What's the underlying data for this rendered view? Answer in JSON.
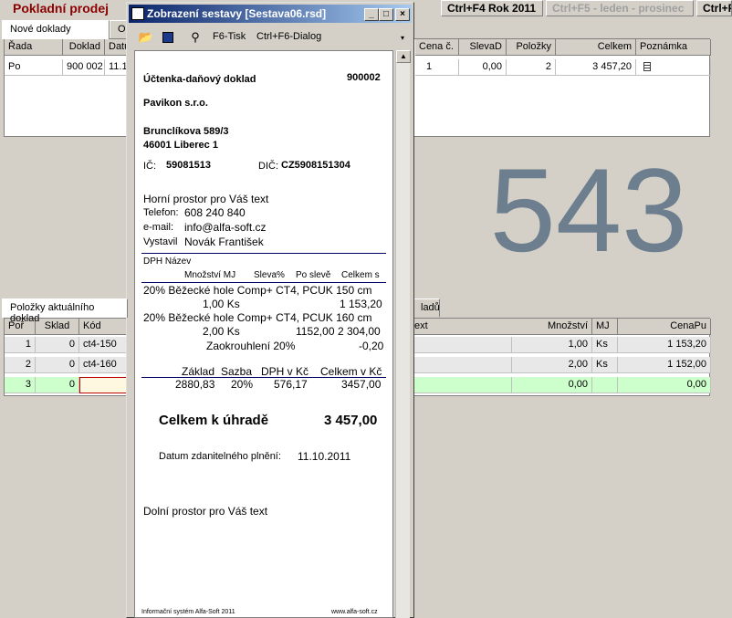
{
  "app": {
    "title": "Pokladní prodej",
    "buttons": [
      "Ctrl+F4 Rok 2011",
      "Ctrl+F5 - leden - prosinec",
      "Ctrl+F"
    ]
  },
  "upper": {
    "tabs": [
      "Nové doklady",
      "Op"
    ],
    "columns": [
      "Řada",
      "Doklad",
      "Datu",
      "Cena č.",
      "SlevaD",
      "Položky",
      "Celkem",
      "Poznámka"
    ],
    "row": {
      "rada": "Po",
      "doklad": "900 002",
      "datum": "11.1",
      "cena": "1",
      "sleva": "0,00",
      "polozky": "2",
      "celkem": "3 457,20"
    }
  },
  "big_number": "543",
  "lower": {
    "tabs": [
      "Položky aktuálního doklad",
      "ladů"
    ],
    "columns": [
      "Poř",
      "Sklad",
      "Kód",
      "ext",
      "Množství",
      "MJ",
      "CenaPu"
    ],
    "rows": [
      {
        "por": "1",
        "sklad": "0",
        "kod": "ct4-150",
        "mnozstvi": "1,00",
        "mj": "Ks",
        "cena": "1 153,20"
      },
      {
        "por": "2",
        "sklad": "0",
        "kod": "ct4-160",
        "mnozstvi": "2,00",
        "mj": "Ks",
        "cena": "1 152,00"
      },
      {
        "por": "3",
        "sklad": "0",
        "kod": "",
        "mnozstvi": "0,00",
        "mj": "",
        "cena": "0,00"
      }
    ]
  },
  "dialog": {
    "title": "Zobrazení sestavy [Sestava06.rsd]",
    "toolbar": {
      "print": "F6-Tisk",
      "dialog": "Ctrl+F6-Dialog"
    },
    "receipt": {
      "heading": "Účtenka-daňový doklad",
      "number": "900002",
      "company": "Pavikon s.r.o.",
      "street": "Brunclíkova 589/3",
      "city": "46001  Liberec 1",
      "ic_label": "IČ:",
      "ic": "59081513",
      "dic_label": "DIČ:",
      "dic": "CZ5908151304",
      "top_text": "Horní prostor pro Váš text",
      "phone_label": "Telefon:",
      "phone": "608 240 840",
      "email_label": "e-mail:",
      "email": "info@alfa-soft.cz",
      "issued_label": "Vystavil",
      "issued": "Novák František",
      "head1": "DPH  Název",
      "head2": [
        "Množství MJ",
        "Sleva%",
        "Po slevě",
        "Celkem s"
      ],
      "items": [
        {
          "line1": "20% Běžecké hole Comp+ CT4, PCUK 150 cm",
          "qty": "1,00 Ks",
          "after": "",
          "total": "1 153,20"
        },
        {
          "line1": "20% Běžecké hole Comp+ CT4, PCUK 160 cm",
          "qty": "2,00 Ks",
          "after": "1152,00",
          "total": "2 304,00"
        }
      ],
      "rounding_label": "Zaokrouhlení 20%",
      "rounding": "-0,20",
      "tax_head": [
        "Základ",
        "Sazba",
        "DPH v Kč",
        "Celkem v Kč"
      ],
      "tax_row": [
        "2880,83",
        "20%",
        "576,17",
        "3457,00"
      ],
      "total_label": "Celkem k úhradě",
      "total": "3 457,00",
      "date_label": "Datum zdanitelného plnění:",
      "date": "11.10.2011",
      "bottom_text": "Dolní prostor pro Váš text",
      "footer_left": "Informační systém Alfa-Soft 2011",
      "footer_right": "www.alfa-soft.cz"
    }
  }
}
